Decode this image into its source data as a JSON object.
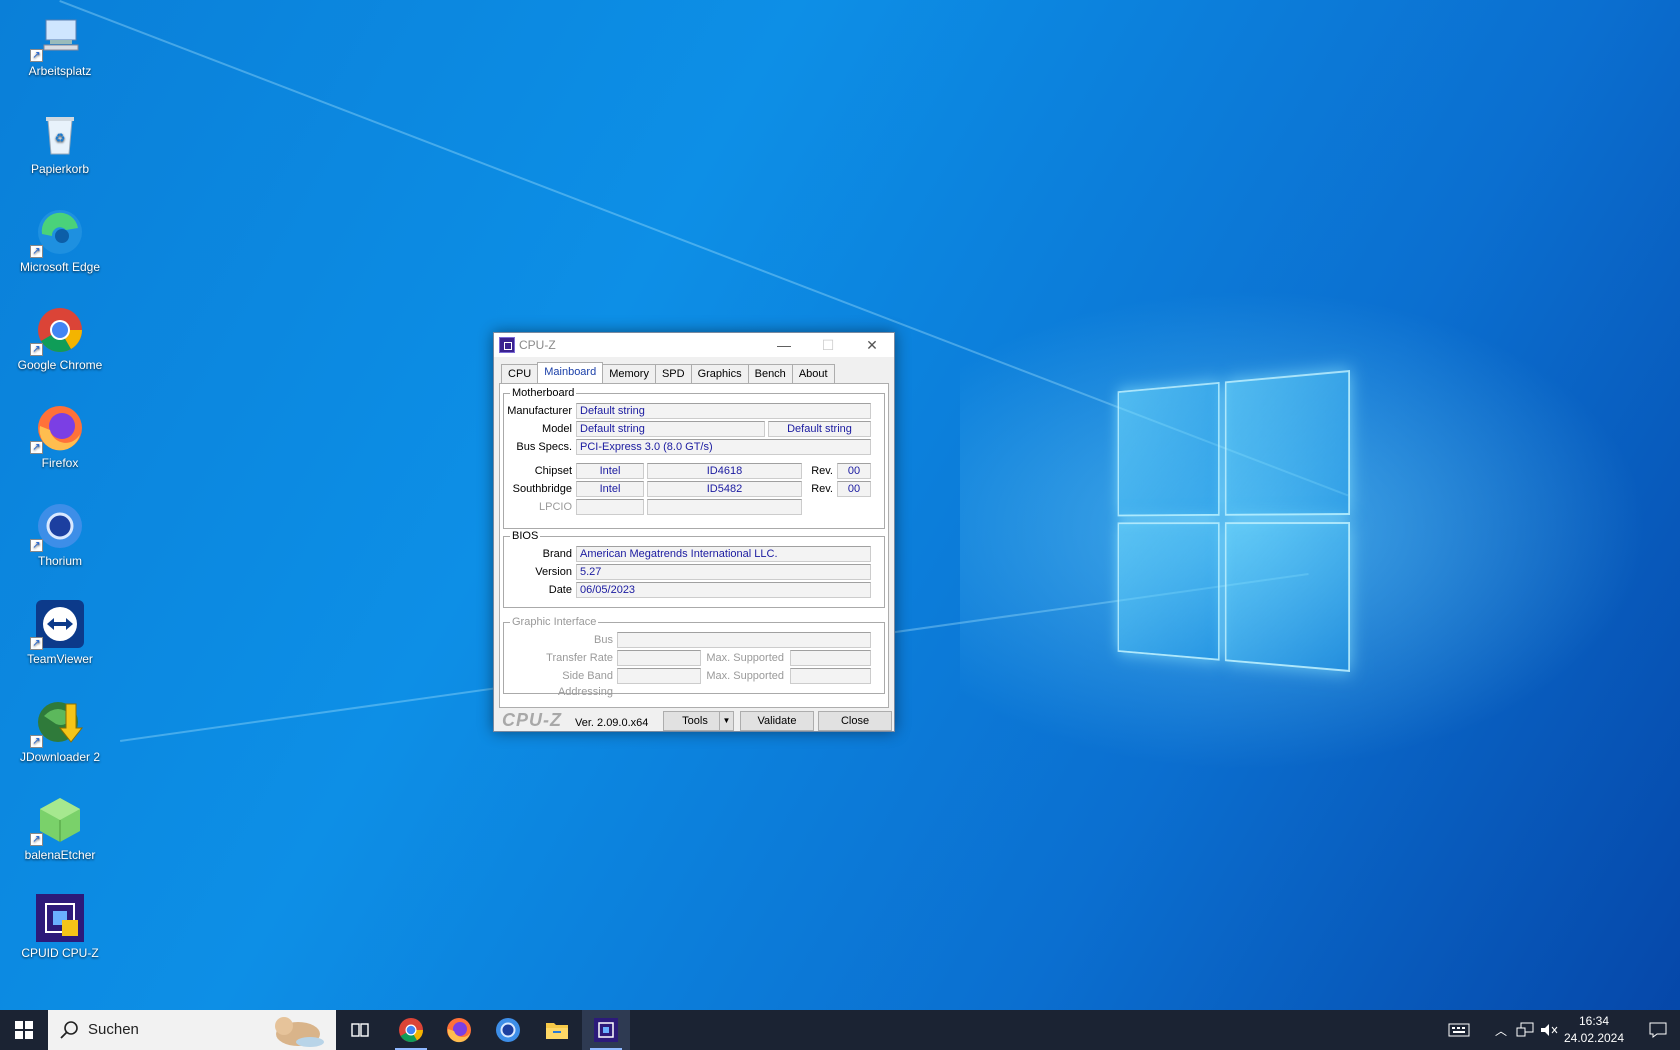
{
  "desktop": {
    "icons": [
      {
        "label": "Arbeitsplatz",
        "icon": "computer-icon"
      },
      {
        "label": "Papierkorb",
        "icon": "recycle-bin-icon"
      },
      {
        "label": "Microsoft Edge",
        "icon": "edge-icon"
      },
      {
        "label": "Google Chrome",
        "icon": "chrome-icon"
      },
      {
        "label": "Firefox",
        "icon": "firefox-icon"
      },
      {
        "label": "Thorium",
        "icon": "thorium-icon"
      },
      {
        "label": "TeamViewer",
        "icon": "teamviewer-icon"
      },
      {
        "label": "JDownloader 2",
        "icon": "jdownloader-icon"
      },
      {
        "label": "balenaEtcher",
        "icon": "balenaetcher-icon"
      },
      {
        "label": "CPUID CPU-Z",
        "icon": "cpuz-icon"
      }
    ]
  },
  "window": {
    "title": "CPU-Z",
    "controls": {
      "minimize": "—",
      "maximize": "☐",
      "close": "✕"
    },
    "tabs": [
      "CPU",
      "Mainboard",
      "Memory",
      "SPD",
      "Graphics",
      "Bench",
      "About"
    ],
    "active_tab": "Mainboard",
    "motherboard": {
      "legend": "Motherboard",
      "manufacturer_label": "Manufacturer",
      "manufacturer": "Default string",
      "model_label": "Model",
      "model": "Default string",
      "model_revision": "Default string",
      "bus_specs_label": "Bus Specs.",
      "bus_specs": "PCI-Express 3.0 (8.0 GT/s)",
      "chipset_label": "Chipset",
      "chipset_vendor": "Intel",
      "chipset_id": "ID4618",
      "chipset_rev_label": "Rev.",
      "chipset_rev": "00",
      "southbridge_label": "Southbridge",
      "southbridge_vendor": "Intel",
      "southbridge_id": "ID5482",
      "southbridge_rev_label": "Rev.",
      "southbridge_rev": "00",
      "lpcio_label": "LPCIO"
    },
    "bios": {
      "legend": "BIOS",
      "brand_label": "Brand",
      "brand": "American Megatrends International LLC.",
      "version_label": "Version",
      "version": "5.27",
      "date_label": "Date",
      "date": "06/05/2023"
    },
    "graphic_interface": {
      "legend": "Graphic Interface",
      "bus_label": "Bus",
      "transfer_rate_label": "Transfer Rate",
      "max_supported_label": "Max. Supported",
      "side_band_label": "Side Band Addressing",
      "max_supported_label_2": "Max. Supported"
    },
    "footer": {
      "brand": "CPU-Z",
      "version": "Ver. 2.09.0.x64",
      "tools": "Tools",
      "validate": "Validate",
      "close": "Close"
    }
  },
  "taskbar": {
    "search_placeholder": "Suchen",
    "apps": [
      "task-view-icon",
      "chrome-icon",
      "firefox-icon",
      "thorium-icon",
      "file-explorer-icon",
      "cpuz-icon"
    ],
    "active_app": "cpuz-icon",
    "time": "16:34",
    "date": "24.02.2024"
  }
}
